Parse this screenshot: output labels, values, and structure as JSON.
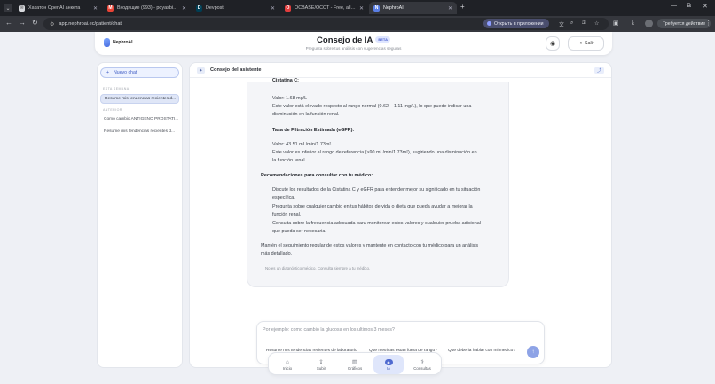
{
  "browser": {
    "tabs": [
      {
        "title": "Хакатон OpenAI анкета",
        "favicon": "mail-icon",
        "color": "#d7d9dd"
      },
      {
        "title": "Входящие (993) - pdyasbi@gm...",
        "favicon": "gmail-icon",
        "color": "#ea4335"
      },
      {
        "title": "Devpost",
        "favicon": "devpost-icon",
        "color": "#003e54"
      },
      {
        "title": "OCBASE/OCCT - Free, all-in-one...",
        "favicon": "occt-icon",
        "color": "#e23d3d"
      },
      {
        "title": "NephroAI",
        "favicon": "nephroai-icon",
        "color": "#5a7fe6"
      }
    ],
    "url": "app.nephroai.ec/patient/chat",
    "open_in_app": "Открыть в приложении",
    "update_button": "Требуется действие"
  },
  "header": {
    "logo": "NephroAI",
    "title": "Consejo de IA",
    "badge": "BETA",
    "subtitle": "Pregunta sobre tus análisis con sugerencias seguras",
    "logout": "Salir"
  },
  "sidebar": {
    "new_chat": "Nuevo chat",
    "section_recent": "ESTA SEMANA",
    "section_older": "ANTERIOR",
    "items": [
      {
        "label": "Resume mis tendencias recientes d...",
        "active": true
      },
      {
        "label": "Como cambio ANTIGENO PROSTATI...",
        "active": false
      },
      {
        "label": "Resume mis tendencias recientes d...",
        "active": false
      }
    ]
  },
  "chat": {
    "panel_title": "Consejo del asistente",
    "message": {
      "cistatina_heading": "Cistatina C:",
      "cistatina_value": "Valor: 1.68 mg/L",
      "cistatina_desc_1": "Este valor está elevado respecto al rango normal (0.62 – 1.11 mg/L), lo que puede indicar una",
      "cistatina_desc_2": "disminución en la función renal.",
      "egfr_heading": "Tasa de Filtración Estimada (eGFR):",
      "egfr_value": "Valor: 43.51 mL/min/1.73m²",
      "egfr_desc_1": "Este valor es inferior al rango de referencia (>90 mL/min/1.73m²), sugiriendo una disminución en",
      "egfr_desc_2": "la función renal.",
      "recs_heading": "Recomendaciones para consultar con tu médico:",
      "rec_1a": "Discute los resultados de la Cistatina C y eGFR para entender mejor su significado en tu situación",
      "rec_1b": "específica.",
      "rec_2a": "Pregunta sobre cualquier cambio en tus hábitos de vida o dieta que pueda ayudar a mejorar la",
      "rec_2b": "función renal.",
      "rec_3a": "Consulta sobre la frecuencia adecuada para monitorear estos valores y cualquier prueba adicional",
      "rec_3b": "que pueda ser necesaria.",
      "closing_1": "Mantén el seguimiento regular de estos valores y mantente en contacto con tu médico para un análisis",
      "closing_2": "más detallado.",
      "disclaimer": "No es un diagnóstico médico. Consulta siempre a tu médico."
    },
    "input_placeholder": "Por ejemplo: como cambio la glucosa en los ultimos 3 meses?",
    "suggestions": [
      "Resume mis tendencias recientes de laboratorio",
      "Que metricas estan fuera de rango?",
      "Que deberia hablar con mi medico?"
    ]
  },
  "bottom_nav": [
    {
      "label": "Inicio",
      "icon": "home-icon",
      "active": false
    },
    {
      "label": "Subir",
      "icon": "upload-icon",
      "active": false
    },
    {
      "label": "Gráficos",
      "icon": "chart-icon",
      "active": false
    },
    {
      "label": "IA",
      "icon": "ai-icon",
      "active": true
    },
    {
      "label": "Consultas",
      "icon": "stethoscope-icon",
      "active": false
    }
  ],
  "colors": {
    "accent": "#4f6ad0",
    "accent_light": "#dfe6fb",
    "page_bg": "#eef0f5"
  }
}
